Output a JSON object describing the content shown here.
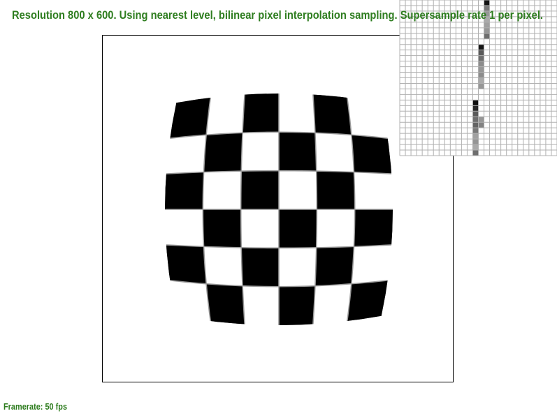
{
  "status": {
    "text": "Resolution 800 x 600. Using nearest level, bilinear pixel interpolation sampling. Supersample rate 1 per pixel."
  },
  "framerate": {
    "text": "Framerate: 50 fps"
  },
  "colors": {
    "overlay_text": "#2e7d1f",
    "frame_border": "#000000",
    "checker_dark": "#000000",
    "checker_light": "#ffffff",
    "seam": "#9a9a9a",
    "zoom_grid_line": "#b0b0b0",
    "zoom_background": "#ffffff"
  },
  "scene": {
    "texture": "checkerboard",
    "checker_rows": 6,
    "checker_cols": 6,
    "distortion": "barrel"
  },
  "zoom_inset": {
    "pixel_columns": 28,
    "pixel_rows": 28,
    "samples": [
      {
        "col": 15,
        "row": 0,
        "gray": 20
      },
      {
        "col": 15,
        "row": 1,
        "gray": 120
      },
      {
        "col": 15,
        "row": 2,
        "gray": 150
      },
      {
        "col": 15,
        "row": 3,
        "gray": 170
      },
      {
        "col": 15,
        "row": 4,
        "gray": 160
      },
      {
        "col": 15,
        "row": 5,
        "gray": 150
      },
      {
        "col": 15,
        "row": 6,
        "gray": 110
      },
      {
        "col": 14,
        "row": 8,
        "gray": 20
      },
      {
        "col": 14,
        "row": 9,
        "gray": 90
      },
      {
        "col": 14,
        "row": 10,
        "gray": 110
      },
      {
        "col": 14,
        "row": 11,
        "gray": 140
      },
      {
        "col": 14,
        "row": 12,
        "gray": 150
      },
      {
        "col": 14,
        "row": 13,
        "gray": 140
      },
      {
        "col": 14,
        "row": 14,
        "gray": 170
      },
      {
        "col": 14,
        "row": 15,
        "gray": 150
      },
      {
        "col": 13,
        "row": 18,
        "gray": 15
      },
      {
        "col": 13,
        "row": 19,
        "gray": 40
      },
      {
        "col": 13,
        "row": 20,
        "gray": 90
      },
      {
        "col": 13,
        "row": 21,
        "gray": 110
      },
      {
        "col": 14,
        "row": 21,
        "gray": 150
      },
      {
        "col": 13,
        "row": 22,
        "gray": 100
      },
      {
        "col": 14,
        "row": 22,
        "gray": 130
      },
      {
        "col": 13,
        "row": 23,
        "gray": 120
      },
      {
        "col": 13,
        "row": 24,
        "gray": 160
      },
      {
        "col": 13,
        "row": 25,
        "gray": 150
      },
      {
        "col": 13,
        "row": 26,
        "gray": 170
      },
      {
        "col": 13,
        "row": 27,
        "gray": 110
      }
    ]
  }
}
